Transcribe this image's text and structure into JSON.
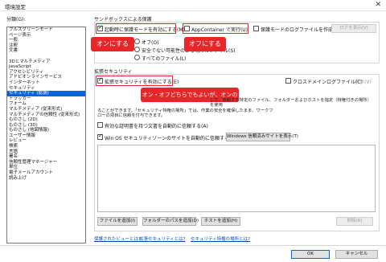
{
  "window": {
    "title": "環境設定",
    "close_glyph": "✕"
  },
  "category_label": "分類(G):",
  "categories": {
    "group1": [
      "フルスクリーンモード",
      "ページ表示",
      "一般",
      "注釈",
      "文書"
    ],
    "group2": [
      "3Dとマルチメディア",
      "JavaScript",
      "アクセシビリティ",
      "アドビオンラインサービス",
      "インターネット",
      "セキュリティ",
      "セキュリティ (拡張)",
      "トラッカー",
      "フォーム",
      "マルチメディア (従来形式)",
      "マルチメディアの信頼性 (従来形式)",
      "ものさし (2D)",
      "ものさし (3D)",
      "ものさし (地図情報)",
      "ユーザー情報",
      "レビュー",
      "検索",
      "言語",
      "署名",
      "信頼性管理マネージャー",
      "単位",
      "電子メールアカウント",
      "読み上げ"
    ],
    "selected": "セキュリティ (拡張)"
  },
  "sandbox": {
    "title": "サンドボックスによる保護",
    "protected_mode": "起動時に保護モードを有効にする(M)",
    "appcontainer": "AppContainer で実行(U)",
    "log_protected": "保護モードのログファイルを作成(L)",
    "view_log_button": "ログを表示(V)",
    "pv_label_suffix": "オフ(O)",
    "pv_unsafe": "安全でない可能性のある場所のファイル(S)",
    "pv_all": "すべてのファイル(L)"
  },
  "enhanced": {
    "title": "拡張セキュリティ",
    "enable": "拡張セキュリティを有効にする(E)",
    "crossdomain": "クロスドメインログファイル(C)",
    "view_button": "表示(V)",
    "para_line1": "して、信頼する特定のファイル、フォルダーおよびホストを指定（特権付きの場所）を使用",
    "para_line2": "ることができます。「セキュリティ特権の場所」では、作業の安全を確保したまま、ワークフ",
    "para_line3": "ローの項目に信頼を付与できます。",
    "auto_cert": "有効な証明書を持つ文書を自動的に信頼する(A)",
    "auto_trust_win": "Win OS セキュリティゾーンのサイトを自動的に信頼する(S)",
    "win_trusted_button": "Windows 信頼済みサイトを表示(T)",
    "add_file_button": "ファイルを追加(I)",
    "add_folder_button": "フォルダーのパスを追加(D)",
    "add_host_button": "ホストを追加(H)",
    "remove_button": "削除(R)"
  },
  "links": {
    "protected_view": "保護されたビューとは?",
    "enhanced": "拡張セキュリティとは?",
    "privileged": "セキュリティ特権の場所とは?"
  },
  "footer": {
    "ok": "OK",
    "cancel": "キャンセル"
  },
  "annotations": {
    "on_label": "オンにする",
    "off_label": "オフにする",
    "either_label": "オン・オフどちらでもよいが、オンの方が良い"
  }
}
